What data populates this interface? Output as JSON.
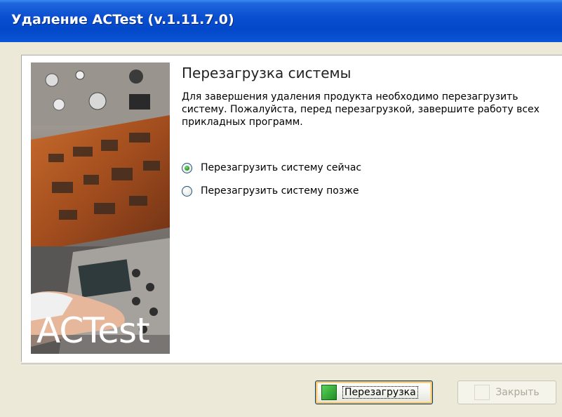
{
  "window": {
    "title": "Удаление ACTest (v.1.11.7.0)"
  },
  "sidebar": {
    "brand_text": "ACTest"
  },
  "content": {
    "heading": "Перезагрузка системы",
    "description": "Для завершения удаления продукта необходимо перезагрузить систему. Пожалуйста, перед перезагрузкой, завершите работу всех прикладных программ.",
    "options": [
      {
        "label": "Перезагрузить систему сейчас",
        "selected": true
      },
      {
        "label": "Перезагрузить систему позже",
        "selected": false
      }
    ]
  },
  "buttons": {
    "restart_label": "Перезагрузка",
    "close_label": "Закрыть",
    "close_enabled": false
  },
  "colors": {
    "titlebar": "#0a4fd0",
    "dialog_bg": "#ece9d8",
    "accent_green": "#2e9a30"
  }
}
